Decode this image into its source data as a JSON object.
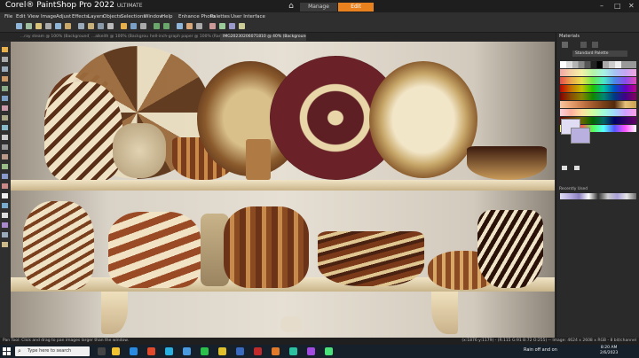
{
  "app": {
    "brand": "Corel® PaintShop Pro 2022",
    "edition": "ULTIMATE",
    "modes": {
      "home_glyph": "⌂",
      "manage": "Manage",
      "edit": "Edit"
    },
    "window_controls": {
      "minimize": "–",
      "maximize": "□",
      "close": "✕"
    }
  },
  "menu": [
    "File",
    "Edit",
    "View",
    "Image",
    "Adjust",
    "Effects",
    "Layers",
    "Objects",
    "Selections",
    "Window",
    "Help",
    "Enhance Photo",
    "Palettes",
    "User Interface"
  ],
  "tabs": [
    {
      "label": "...ray steam @ 100% (Background)"
    },
    {
      "label": "...alkeith @ 100% (Background)"
    },
    {
      "label": "hell-inch-graph paper @ 100% (Raster 1)"
    },
    {
      "label": "IMG20230206071810 @ 40% (Background)",
      "active": true
    }
  ],
  "materials": {
    "title": "Materials",
    "palette_name": "Standard Palette",
    "recent_label": "Recently Used"
  },
  "status": {
    "left": "Pan Tool: Click and drag to pan images larger than the window.",
    "right": "(x:1876 y:1179) - (R:115 G:91 B:72 O:255) -- Image: 4624 x 2608 x RGB - 8 bit/channel"
  },
  "taskbar": {
    "search_placeholder": "Type here to search",
    "weather": "Rain off and on",
    "time": "8:20 AM",
    "date": "2/6/2023"
  },
  "colors": {
    "accent": "#e8811e",
    "panel_bg": "#2a2a2a",
    "taskbar_bg": "#16202b"
  },
  "icons": [
    "home-icon",
    "search-icon",
    "windows-start-icon"
  ]
}
